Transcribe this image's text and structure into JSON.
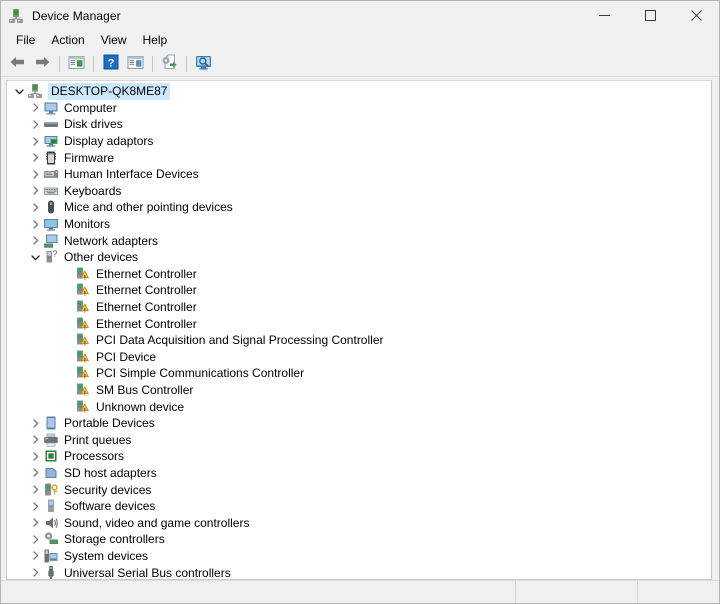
{
  "window": {
    "title": "Device Manager",
    "icon": "device-manager-icon",
    "caption_buttons": [
      {
        "name": "minimize-button",
        "label": "Minimize"
      },
      {
        "name": "maximize-button",
        "label": "Maximize"
      },
      {
        "name": "close-button",
        "label": "Close"
      }
    ]
  },
  "menubar": {
    "items": [
      {
        "label": "File"
      },
      {
        "label": "Action"
      },
      {
        "label": "View"
      },
      {
        "label": "Help"
      }
    ]
  },
  "toolbar": {
    "buttons": [
      {
        "name": "back-button",
        "icon": "back-arrow-icon",
        "tooltip": "Back"
      },
      {
        "name": "forward-button",
        "icon": "forward-arrow-icon",
        "tooltip": "Forward"
      },
      {
        "name": "separator-1",
        "icon": "separator",
        "tooltip": ""
      },
      {
        "name": "show-hide-console-tree-button",
        "icon": "console-tree-icon",
        "tooltip": "Show/Hide Console Tree"
      },
      {
        "name": "separator-2",
        "icon": "separator",
        "tooltip": ""
      },
      {
        "name": "help-button",
        "icon": "help-question-icon",
        "tooltip": "Help"
      },
      {
        "name": "properties-button",
        "icon": "properties-window-icon",
        "tooltip": "Properties"
      },
      {
        "name": "separator-3",
        "icon": "separator",
        "tooltip": ""
      },
      {
        "name": "update-driver-button",
        "icon": "update-driver-icon",
        "tooltip": "Update Driver Software"
      },
      {
        "name": "separator-4",
        "icon": "separator",
        "tooltip": ""
      },
      {
        "name": "scan-hardware-changes-button",
        "icon": "scan-monitor-icon",
        "tooltip": "Scan for hardware changes"
      }
    ]
  },
  "tree": {
    "root": {
      "label": "DESKTOP-QK8ME87",
      "icon": "computer-root-icon",
      "expanded": true,
      "selected": true
    },
    "nodes": [
      {
        "label": "Computer",
        "icon": "computer-icon",
        "expanded": false,
        "level": 1
      },
      {
        "label": "Disk drives",
        "icon": "disk-drive-icon",
        "expanded": false,
        "level": 1
      },
      {
        "label": "Display adaptors",
        "icon": "display-adapter-icon",
        "expanded": false,
        "level": 1
      },
      {
        "label": "Firmware",
        "icon": "firmware-icon",
        "expanded": false,
        "level": 1
      },
      {
        "label": "Human Interface Devices",
        "icon": "hid-icon",
        "expanded": false,
        "level": 1
      },
      {
        "label": "Keyboards",
        "icon": "keyboard-icon",
        "expanded": false,
        "level": 1
      },
      {
        "label": "Mice and other pointing devices",
        "icon": "mouse-icon",
        "expanded": false,
        "level": 1
      },
      {
        "label": "Monitors",
        "icon": "monitor-icon",
        "expanded": false,
        "level": 1
      },
      {
        "label": "Network adapters",
        "icon": "network-adapter-icon",
        "expanded": false,
        "level": 1
      },
      {
        "label": "Other devices",
        "icon": "other-devices-icon",
        "expanded": true,
        "level": 1
      },
      {
        "label": "Ethernet Controller",
        "icon": "warning-device-icon",
        "expanded": null,
        "level": 2
      },
      {
        "label": "Ethernet Controller",
        "icon": "warning-device-icon",
        "expanded": null,
        "level": 2
      },
      {
        "label": "Ethernet Controller",
        "icon": "warning-device-icon",
        "expanded": null,
        "level": 2
      },
      {
        "label": "Ethernet Controller",
        "icon": "warning-device-icon",
        "expanded": null,
        "level": 2
      },
      {
        "label": "PCI Data Acquisition and Signal Processing Controller",
        "icon": "warning-device-icon",
        "expanded": null,
        "level": 2
      },
      {
        "label": "PCI Device",
        "icon": "warning-device-icon",
        "expanded": null,
        "level": 2
      },
      {
        "label": "PCI Simple Communications Controller",
        "icon": "warning-device-icon",
        "expanded": null,
        "level": 2
      },
      {
        "label": "SM Bus Controller",
        "icon": "warning-device-icon",
        "expanded": null,
        "level": 2
      },
      {
        "label": "Unknown device",
        "icon": "warning-device-icon",
        "expanded": null,
        "level": 2
      },
      {
        "label": "Portable Devices",
        "icon": "portable-device-icon",
        "expanded": false,
        "level": 1
      },
      {
        "label": "Print queues",
        "icon": "printer-icon",
        "expanded": false,
        "level": 1
      },
      {
        "label": "Processors",
        "icon": "processor-icon",
        "expanded": false,
        "level": 1
      },
      {
        "label": "SD host adapters",
        "icon": "sd-host-adapter-icon",
        "expanded": false,
        "level": 1
      },
      {
        "label": "Security devices",
        "icon": "security-device-icon",
        "expanded": false,
        "level": 1
      },
      {
        "label": "Software devices",
        "icon": "software-device-icon",
        "expanded": false,
        "level": 1
      },
      {
        "label": "Sound, video and game controllers",
        "icon": "sound-icon",
        "expanded": false,
        "level": 1
      },
      {
        "label": "Storage controllers",
        "icon": "storage-controller-icon",
        "expanded": false,
        "level": 1
      },
      {
        "label": "System devices",
        "icon": "system-device-icon",
        "expanded": false,
        "level": 1
      },
      {
        "label": "Universal Serial Bus controllers",
        "icon": "usb-icon",
        "expanded": false,
        "level": 1
      }
    ]
  },
  "statusbar": {
    "panes": [
      "",
      "",
      ""
    ]
  },
  "colors": {
    "window_chrome": "#f0f0f0",
    "tree_background": "#ffffff",
    "selection": "#cce8ff",
    "warning_yellow": "#ffd24a",
    "accent_blue": "#0078d7"
  }
}
